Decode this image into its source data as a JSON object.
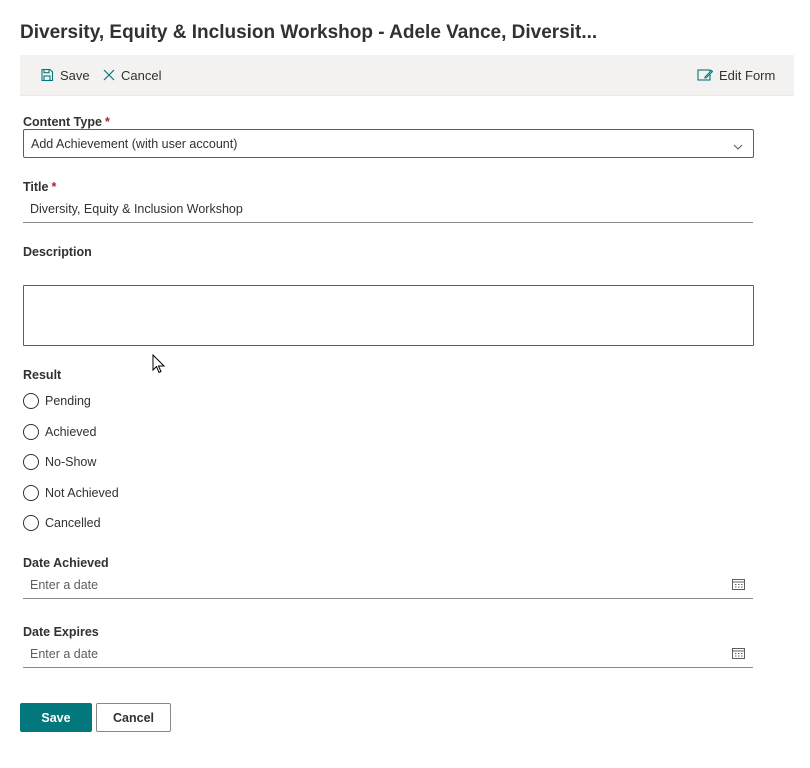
{
  "header": {
    "title": "Diversity, Equity & Inclusion Workshop - Adele Vance, Diversit..."
  },
  "commandbar": {
    "save_label": "Save",
    "cancel_label": "Cancel",
    "edit_form_label": "Edit Form"
  },
  "form": {
    "content_type": {
      "label": "Content Type",
      "required_mark": "*",
      "value": "Add Achievement (with user account)"
    },
    "title": {
      "label": "Title",
      "required_mark": "*",
      "value": "Diversity, Equity & Inclusion Workshop"
    },
    "description": {
      "label": "Description",
      "value": ""
    },
    "result": {
      "label": "Result",
      "options": [
        "Pending",
        "Achieved",
        "No-Show",
        "Not Achieved",
        "Cancelled"
      ]
    },
    "date_achieved": {
      "label": "Date Achieved",
      "placeholder": "Enter a date"
    },
    "date_expires": {
      "label": "Date Expires",
      "placeholder": "Enter a date"
    }
  },
  "footer": {
    "save_label": "Save",
    "cancel_label": "Cancel"
  },
  "colors": {
    "accent": "#03787c",
    "required": "#a4262c",
    "commandbar_bg": "#f3f2f1"
  },
  "icons": {
    "save": "save-icon",
    "cancel": "close-icon",
    "edit_form": "edit-form-icon",
    "calendar": "calendar-icon",
    "dropdown": "chevron-down-icon"
  }
}
